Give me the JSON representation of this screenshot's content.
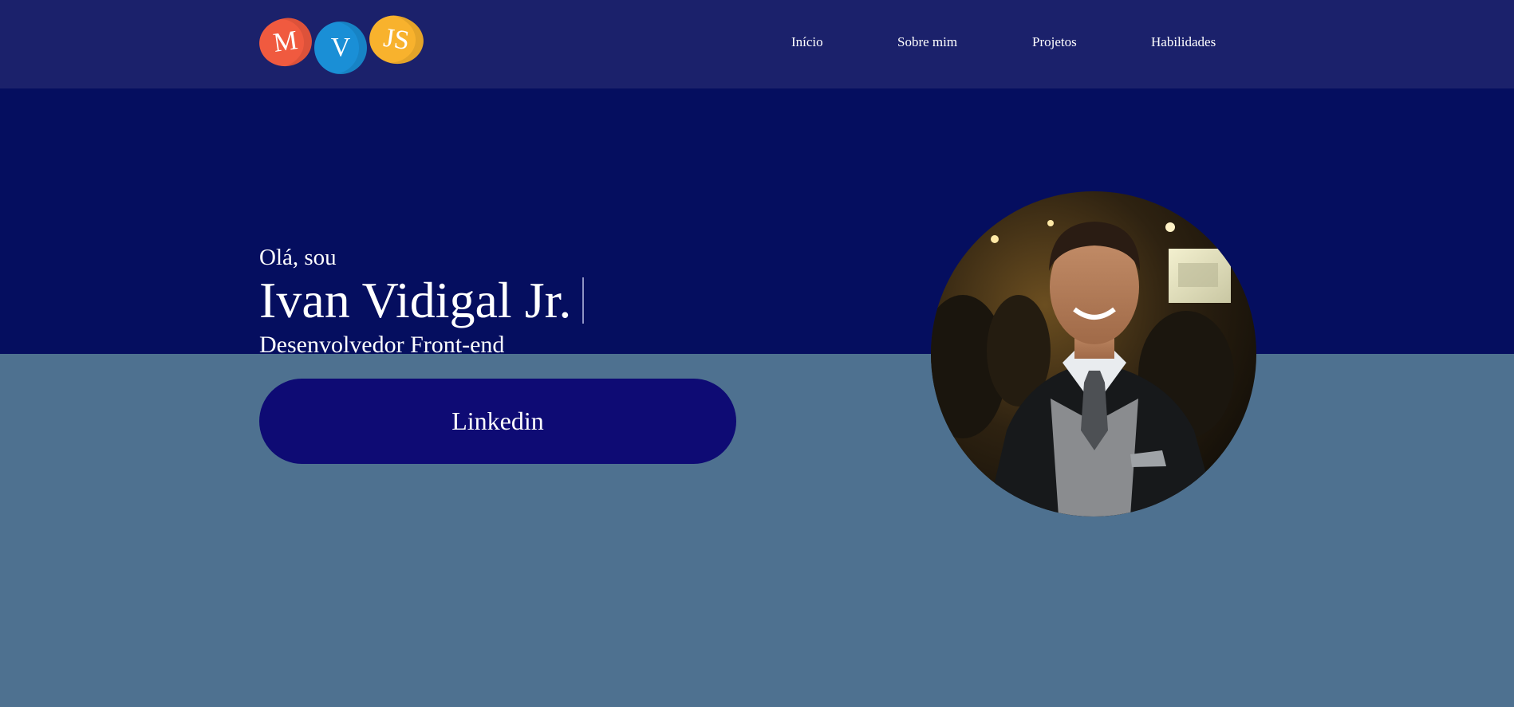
{
  "header": {
    "logo": {
      "letters": [
        "M",
        "V",
        "JS"
      ],
      "colors": [
        "#f05a3f",
        "#1a8fd6",
        "#f8b22d"
      ]
    },
    "nav": [
      {
        "label": "Início"
      },
      {
        "label": "Sobre mim"
      },
      {
        "label": "Projetos"
      },
      {
        "label": "Habilidades"
      }
    ]
  },
  "hero": {
    "greeting": "Olá, sou",
    "name": "Ivan Vidigal Jr.",
    "role": "Desenvolvedor Front-end",
    "button_label": "Linkedin",
    "photo_icon": "profile-photo"
  },
  "colors": {
    "header_bg": "#1b216b",
    "hero_dark_bg": "#050e5f",
    "hero_light_bg": "#4e7190",
    "button_bg": "#0e0b74"
  }
}
